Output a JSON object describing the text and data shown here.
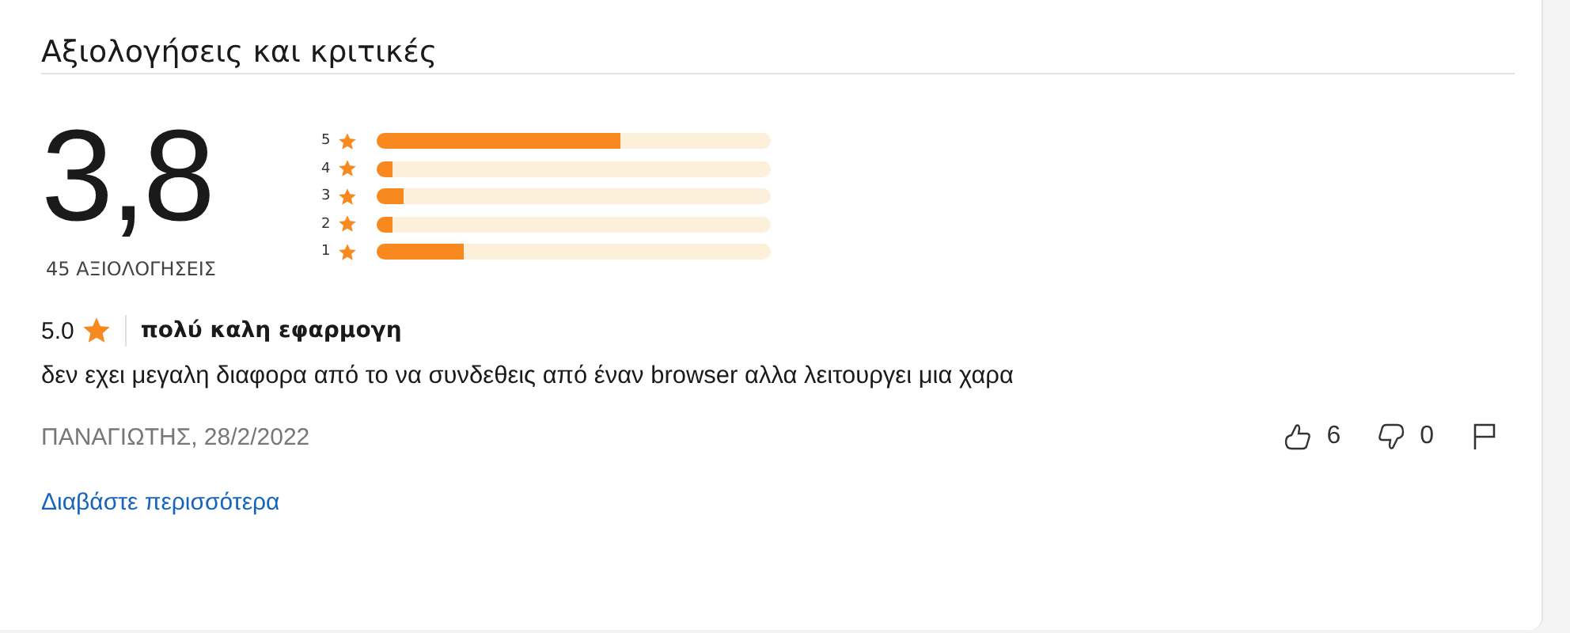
{
  "title": "Αξιολογήσεις και κριτικές",
  "summary": {
    "average": "3,8",
    "count": "45 ΑΞΙΟΛΟΓΗΣΕΙΣ",
    "distribution": [
      {
        "label": "5",
        "level": 0.62
      },
      {
        "label": "4",
        "level": 0.04
      },
      {
        "label": "3",
        "level": 0.07
      },
      {
        "label": "2",
        "level": 0.04
      },
      {
        "label": "1",
        "level": 0.22
      }
    ]
  },
  "review": {
    "rating": "5.0",
    "title": "πολύ καλη εφαρμογη",
    "body": "δεν εχει μεγαλη διαφορα από το να συνδεθεις από έναν browser αλλα λειτουργει μια χαρα",
    "author_date": "ΠΑΝΑΓΙΩΤΗΣ, 28/2/2022",
    "likes": "6",
    "dislikes": "0"
  },
  "read_more": "Διαβάστε περισσότερα"
}
